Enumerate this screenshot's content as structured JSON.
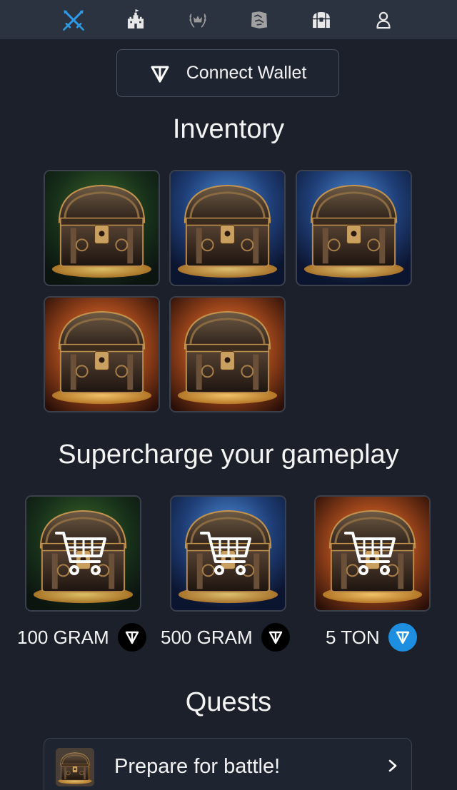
{
  "nav": {
    "items": [
      {
        "icon": "crossed-swords-icon",
        "active": true,
        "color": "#2e9be6"
      },
      {
        "icon": "castle-icon",
        "active": false
      },
      {
        "icon": "crown-laurel-icon",
        "active": false
      },
      {
        "icon": "map-icon",
        "active": false
      },
      {
        "icon": "treasure-chest-icon",
        "active": false
      },
      {
        "icon": "user-icon",
        "active": false
      }
    ]
  },
  "wallet": {
    "label": "Connect Wallet",
    "icon": "ton-icon"
  },
  "inventory": {
    "title": "Inventory",
    "items": [
      {
        "variant": "green"
      },
      {
        "variant": "blue"
      },
      {
        "variant": "blue"
      },
      {
        "variant": "orange"
      },
      {
        "variant": "orange"
      }
    ]
  },
  "shop": {
    "title": "Supercharge your gameplay",
    "items": [
      {
        "variant": "green",
        "price": "100 GRAM",
        "badge_color": "#000000"
      },
      {
        "variant": "blue",
        "price": "500 GRAM",
        "badge_color": "#000000"
      },
      {
        "variant": "orange",
        "price": "5 TON",
        "badge_color": "#1e8fe0"
      }
    ]
  },
  "quests": {
    "title": "Quests",
    "items": [
      {
        "label": "Prepare for battle!",
        "icon": "chevron-right-icon"
      }
    ]
  },
  "colors": {
    "background": "#1b202b",
    "nav_background": "#2b3240",
    "accent": "#2e9be6"
  }
}
